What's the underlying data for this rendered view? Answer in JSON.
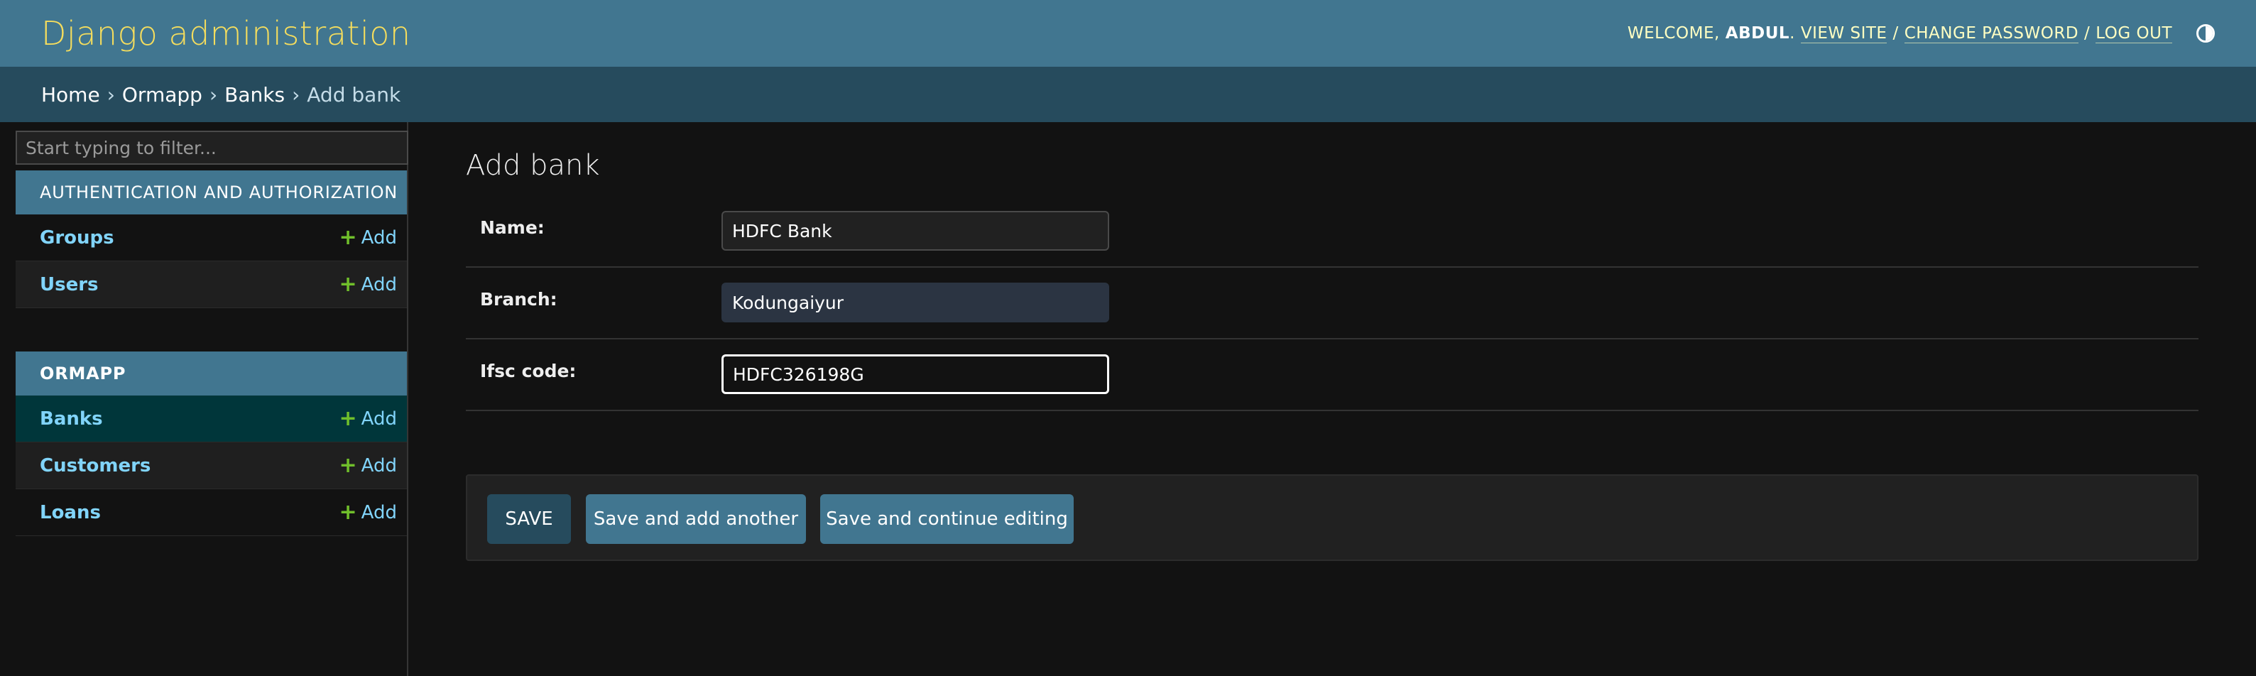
{
  "header": {
    "title": "Django administration",
    "welcome": "Welcome,",
    "username": "ABDUL",
    "username_suffix": ".",
    "view_site": "View site",
    "change_password": "Change password",
    "log_out": "Log out",
    "separator": "/",
    "theme_icon": "theme-toggle-icon"
  },
  "breadcrumbs": {
    "items": [
      "Home",
      "Ormapp",
      "Banks"
    ],
    "current": "Add bank",
    "separator": "›"
  },
  "sidebar": {
    "filter_placeholder": "Start typing to filter...",
    "modules": [
      {
        "caption": "Authentication and Authorization",
        "models": [
          {
            "name": "Groups",
            "add": "Add"
          },
          {
            "name": "Users",
            "add": "Add"
          }
        ]
      },
      {
        "caption": "Ormapp",
        "models": [
          {
            "name": "Banks",
            "add": "Add",
            "selected": true
          },
          {
            "name": "Customers",
            "add": "Add"
          },
          {
            "name": "Loans",
            "add": "Add"
          }
        ]
      }
    ]
  },
  "content": {
    "title": "Add bank",
    "fields": [
      {
        "label": "Name:",
        "value": "HDFC Bank"
      },
      {
        "label": "Branch:",
        "value": "Kodungaiyur"
      },
      {
        "label": "Ifsc code:",
        "value": "HDFC326198G"
      }
    ],
    "buttons": {
      "save": "Save",
      "save_add_another": "Save and add another",
      "save_continue": "Save and continue editing"
    }
  },
  "colors": {
    "header_bg": "#417690",
    "branding": "#f5dd5d",
    "breadcrumbs_bg": "#264b5d",
    "link": "#81d4fa",
    "add_icon": "#70bf2b",
    "selected_row": "#00363a"
  }
}
